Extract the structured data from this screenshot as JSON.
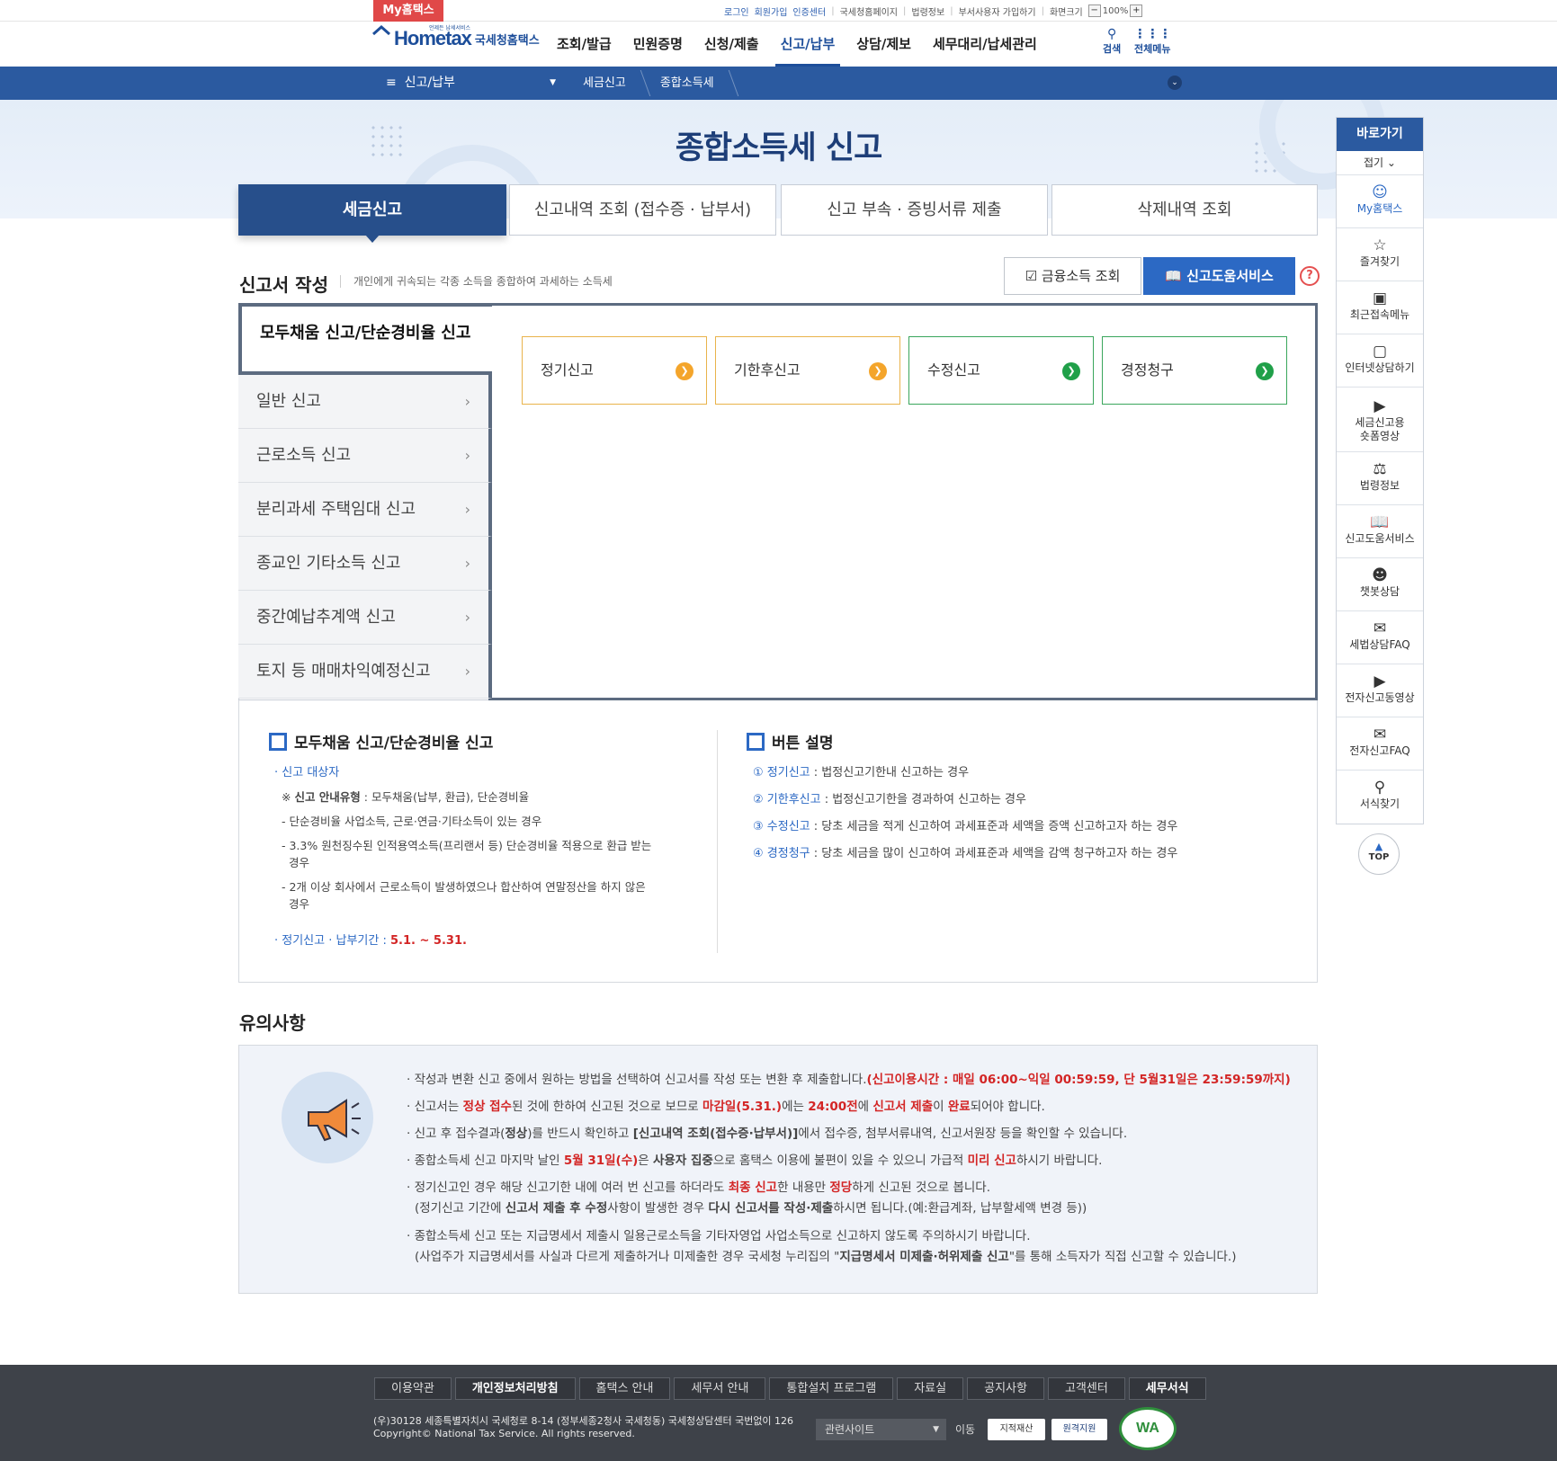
{
  "top_util": {
    "my_hometax": "My홈택스",
    "links": [
      "로그인",
      "회원가입",
      "인증센터"
    ],
    "plain_links": [
      "국세청홈페이지",
      "법령정보",
      "부서사용자 가입하기",
      "화면크기"
    ],
    "zoom": "100%",
    "zoom_minus": "−",
    "zoom_plus": "+"
  },
  "header": {
    "logo_main": "Hometax",
    "logo_sub": "국세청홈택스",
    "logo_tag": "언제든 납세서비스",
    "gnb": [
      "조회/발급",
      "민원증명",
      "신청/제출",
      "신고/납부",
      "상담/제보",
      "세무대리/납세관리"
    ],
    "search_label": "검색",
    "menu_label": "전체메뉴"
  },
  "navbar": {
    "menu_select": "신고/납부",
    "crumbs": [
      "세금신고",
      "종합소득세"
    ]
  },
  "page_title": "종합소득세 신고",
  "tabs": [
    "세금신고",
    "신고내역 조회 (접수증 · 납부서)",
    "신고 부속 · 증빙서류 제출",
    "삭제내역 조회"
  ],
  "section": {
    "title": "신고서 작성",
    "desc": "개인에게 귀속되는 각종 소득을 종합하여 과세하는 소득세",
    "btn_financial": "금융소득 조회",
    "btn_help": "신고도움서비스",
    "qmark": "?"
  },
  "side_nav": {
    "active": "모두채움 신고/단순경비율 신고",
    "items": [
      "일반 신고",
      "근로소득 신고",
      "분리과세 주택임대 신고",
      "종교인 기타소득 신고",
      "중간예납추계액 신고",
      "토지 등 매매차익예정신고"
    ]
  },
  "report_buttons": [
    "정기신고",
    "기한후신고",
    "수정신고",
    "경정청구"
  ],
  "info_left": {
    "heading": "모두채움 신고/단순경비율 신고",
    "target_label": "신고 대상자",
    "type_label": "신고 안내유형",
    "type_value": " : 모두채움(납부, 환급), 단순경비율",
    "line1": "단순경비율 사업소득, 근로·연금·기타소득이 있는 경우",
    "line2a": "3.3% 원천징수된 인적용역소득(프리랜서 등) 단순경비율 적용으로 환급 받는",
    "line2b": "경우",
    "line3a": "2개 이상 회사에서 근로소득이 발생하였으나 합산하여 연말정산을 하지 않은",
    "line3b": "경우",
    "period_label": "정기신고 · 납부기간 : ",
    "period_value": "5.1. ~ 5.31."
  },
  "info_right": {
    "heading": "버튼 설명",
    "items": [
      {
        "num": "①",
        "name": "정기신고",
        "desc": " : 법정신고기한내 신고하는 경우"
      },
      {
        "num": "②",
        "name": "기한후신고",
        "desc": " : 법정신고기한을 경과하여 신고하는 경우"
      },
      {
        "num": "③",
        "name": "수정신고",
        "desc": " : 당초 세금을 적게 신고하여 과세표준과 세액을 증액 신고하고자 하는 경우"
      },
      {
        "num": "④",
        "name": "경정청구",
        "desc": " : 당초 세금을 많이 신고하여 과세표준과 세액을 감액 청구하고자 하는 경우"
      }
    ]
  },
  "notice": {
    "title": "유의사항",
    "n1": "작성과 변환 신고 중에서 원하는 방법을 선택하여 신고서를 작성 또는 변환 후 제출합니다.",
    "n1_red": "(신고이용시간 : 매일 06:00~익일 00:59:59, 단 5월31일은 23:59:59까지)",
    "n2_a": "신고서는 ",
    "n2_b": "정상 접수",
    "n2_c": "된 것에 한하여 신고된 것으로 보므로 ",
    "n2_d": "마감일(5.31.)",
    "n2_e": "에는 ",
    "n2_f": "24:00전",
    "n2_g": "에 ",
    "n2_h": "신고서 제출",
    "n2_i": "이 ",
    "n2_j": "완료",
    "n2_k": "되어야 합니다.",
    "n3_a": "신고 후 접수결과(",
    "n3_b": "정상",
    "n3_c": ")를 반드시 확인하고 ",
    "n3_d": "[신고내역 조회(접수증·납부서)]",
    "n3_e": "에서 접수증, 첨부서류내역, 신고서원장 등을 확인할 수 있습니다.",
    "n4_a": "종합소득세 신고 마지막 날인 ",
    "n4_b": "5월 31일(수)",
    "n4_c": "은 ",
    "n4_d": "사용자 집중",
    "n4_e": "으로 홈택스 이용에 불편이 있을 수 있으니 가급적 ",
    "n4_f": "미리 신고",
    "n4_g": "하시기 바랍니다.",
    "n5_a": "정기신고인 경우 해당 신고기한 내에 여러 번 신고를 하더라도 ",
    "n5_b": "최종 신고",
    "n5_c": "한 내용만 ",
    "n5_d": "정당",
    "n5_e": "하게 신고된 것으로 봅니다.",
    "n5_2a": "(정기신고 기간에 ",
    "n5_2b": "신고서 제출 후 수정",
    "n5_2c": "사항이 발생한 경우 ",
    "n5_2d": "다시 신고서를 작성·제출",
    "n5_2e": "하시면 됩니다.(예:환급계좌, 납부할세액 변경 등))",
    "n6": "종합소득세 신고 또는 지급명세서 제출시 일용근로소득을 기타자영업 사업소득으로 신고하지 않도록 주의하시기 바랍니다.",
    "n6_2a": "(사업주가 지급명세서를 사실과 다르게 제출하거나 미제출한 경우 국세청 누리집의 \"",
    "n6_2b": "지급명세서 미제출·허위제출 신고",
    "n6_2c": "\"를 통해 소득자가 직접 신고할 수 있습니다.)"
  },
  "quick_menu": {
    "head": "바로가기",
    "fold": "접기 ⌄",
    "items": [
      "My홈택스",
      "즐겨찾기",
      "최근접속메뉴",
      "인터넷상담하기",
      "세금신고용 숏폼영상",
      "법령정보",
      "신고도움서비스",
      "챗봇상담",
      "세법상담FAQ",
      "전자신고동영상",
      "전자신고FAQ",
      "서식찾기"
    ],
    "top": "TOP"
  },
  "footer": {
    "links": [
      "이용약관",
      "개인정보처리방침",
      "홈택스 안내",
      "세무서 안내",
      "통합설치 프로그램",
      "자료실",
      "공지사항",
      "고객센터",
      "세무서식"
    ],
    "address": "(우)30128 세종특별자치시 국세청로 8-14 (정부세종2청사 국세청동) 국세청상담센터 국번없이 126",
    "copyright": "Copyright© National Tax Service. All rights reserved.",
    "related_site": "관련사이트",
    "go": "이동",
    "badge1": "지적재산",
    "badge2": "원격지원",
    "wa": "WA"
  },
  "colors": {
    "primary": "#2b5aa0",
    "accent": "#2c69c4",
    "red": "#d32525",
    "orange": "#f4a52b",
    "green": "#20a049"
  }
}
